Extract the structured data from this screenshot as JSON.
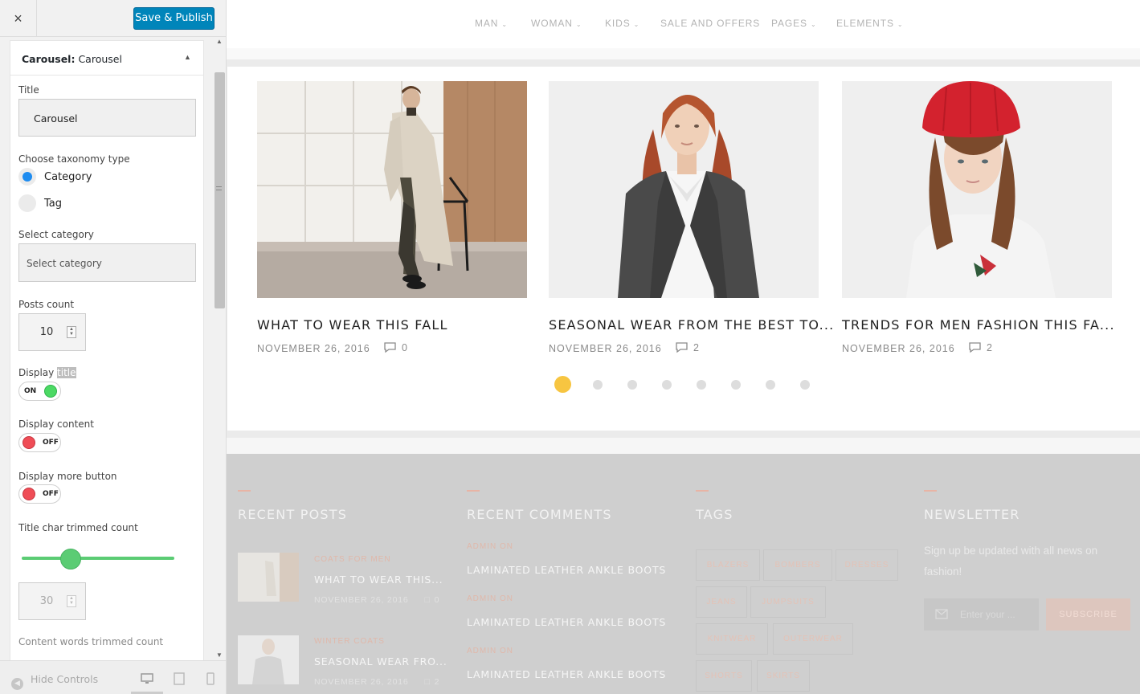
{
  "customizer": {
    "close_label": "×",
    "publish_label": "Save & Publish",
    "section": {
      "type": "Carousel:",
      "name": "Carousel"
    },
    "title_field": {
      "label": "Title",
      "value": "Carousel"
    },
    "taxonomy": {
      "label": "Choose taxonomy type",
      "options": [
        "Category",
        "Tag"
      ],
      "selected": "Category"
    },
    "category": {
      "label": "Select category",
      "placeholder": "Select category"
    },
    "posts_count": {
      "label": "Posts count",
      "value": "10"
    },
    "display_title": {
      "label_pre": "Display ",
      "label_highlight": "title",
      "state": "ON"
    },
    "display_content": {
      "label": "Display content",
      "state": "OFF"
    },
    "display_more": {
      "label": "Display more button",
      "state": "OFF"
    },
    "title_trim": {
      "label": "Title char trimmed count",
      "value": "30",
      "slider_level": 0.32
    },
    "content_words": {
      "label": "Content words trimmed count"
    },
    "hide_controls": "Hide Controls"
  },
  "site": {
    "nav": [
      "MAN",
      "WOMAN",
      "KIDS",
      "SALE AND OFFERS",
      "PAGES",
      "ELEMENTS"
    ],
    "carousel": [
      {
        "title": "WHAT TO WEAR THIS FALL",
        "date": "NOVEMBER 26, 2016",
        "comments": "0"
      },
      {
        "title": "SEASONAL WEAR FROM THE BEST TO...",
        "date": "NOVEMBER 26, 2016",
        "comments": "2"
      },
      {
        "title": "TRENDS FOR MEN FASHION THIS FA...",
        "date": "NOVEMBER 26, 2016",
        "comments": "2"
      }
    ],
    "pagination": {
      "total": 8,
      "active": 1
    },
    "footer": {
      "recent_posts": {
        "title": "RECENT POSTS",
        "items": [
          {
            "category": "COATS FOR MEN",
            "title": "WHAT TO WEAR THIS...",
            "date": "NOVEMBER 26, 2016",
            "comments": "0"
          },
          {
            "category": "WINTER COATS",
            "title": "SEASONAL WEAR FRO...",
            "date": "NOVEMBER 26, 2016",
            "comments": "2"
          }
        ]
      },
      "recent_comments": {
        "title": "RECENT COMMENTS",
        "items": [
          {
            "author": "ADMIN ON",
            "post": "LAMINATED LEATHER ANKLE BOOTS"
          },
          {
            "author": "ADMIN ON",
            "post": "LAMINATED LEATHER ANKLE BOOTS"
          },
          {
            "author": "ADMIN ON",
            "post": "LAMINATED LEATHER ANKLE BOOTS"
          }
        ]
      },
      "tags": {
        "title": "TAGS",
        "items": [
          "BLAZERS",
          "BOMBERS",
          "DRESSES",
          "JEANS",
          "JUMPSUITS",
          "KNITWEAR",
          "OUTERWEAR",
          "SHORTS",
          "SKIRTS"
        ]
      },
      "newsletter": {
        "title": "NEWSLETTER",
        "text": "Sign up be updated with all news on fashion!",
        "placeholder": "Enter your ...",
        "button": "SUBSCRIBE"
      }
    }
  },
  "colors": {
    "publish": "#0085ba",
    "radio_selected": "#1e8cf0",
    "toggle_on": "#4cd964",
    "toggle_off": "#ef4d56",
    "slider": "#5bcc74",
    "dot_active": "#f7c541"
  }
}
